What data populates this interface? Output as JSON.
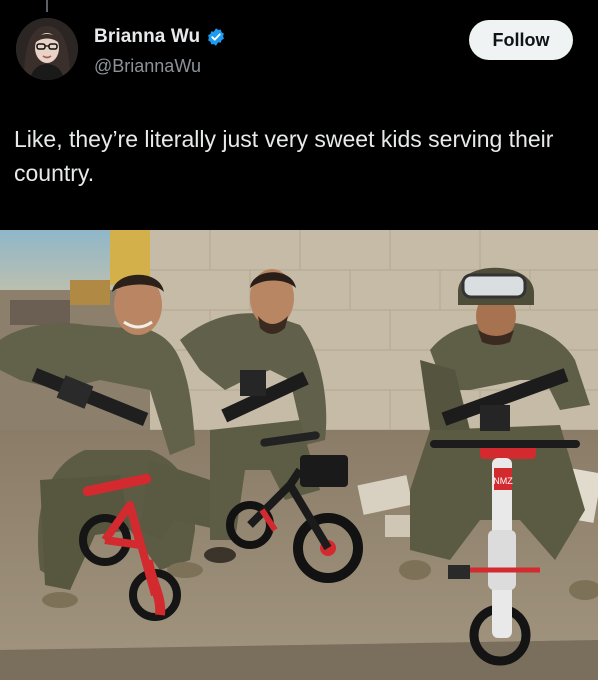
{
  "tweet": {
    "display_name": "Brianna Wu",
    "handle": "@BriannaWu",
    "verified": true,
    "follow_label": "Follow",
    "text": "Like, they’re literally just very sweet kids serving their country."
  },
  "icons": {
    "verified": "verified-badge-icon",
    "avatar": "profile-avatar"
  },
  "colors": {
    "background": "#000000",
    "text": "#e7e9ea",
    "secondary_text": "#8b9399",
    "verified_blue": "#1d9bf0",
    "follow_bg": "#eff3f4"
  },
  "media": {
    "bike_plate_text": "NMZ"
  }
}
